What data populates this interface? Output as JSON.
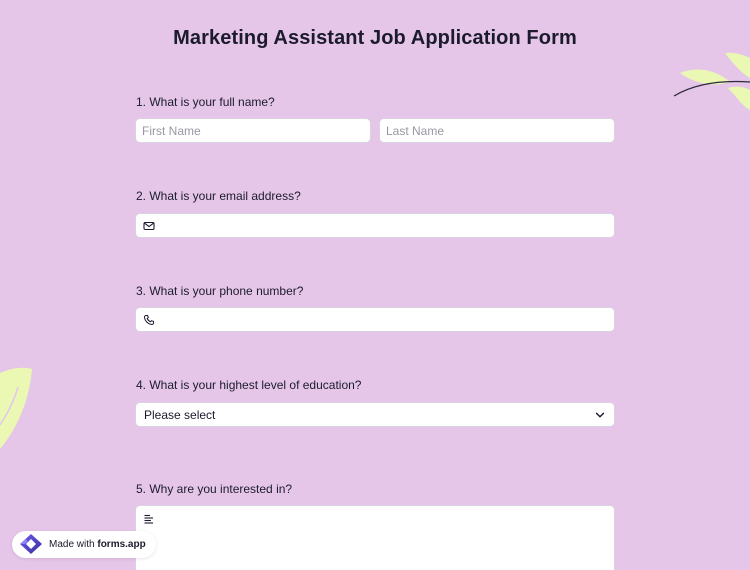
{
  "form": {
    "title": "Marketing Assistant Job Application Form"
  },
  "questions": [
    {
      "label": "1.  What is your full name?",
      "first_name_placeholder": "First Name",
      "last_name_placeholder": "Last Name"
    },
    {
      "label": "2. What is your email address?",
      "icon": "envelope-icon"
    },
    {
      "label": "3. What is your phone number?",
      "icon": "phone-icon"
    },
    {
      "label": "4. What is your highest level of education?",
      "selected_value": "Please select",
      "icon": "chevron-down-icon"
    },
    {
      "label": "5. Why are you interested in?",
      "icon": "text-lines-icon"
    }
  ],
  "badge": {
    "prefix": "Made with ",
    "brand": "forms.app"
  },
  "colors": {
    "background": "#e5c6e8",
    "leaf": "#eaf8b4",
    "brand_gradient_start": "#6b5cf0",
    "brand_gradient_end": "#3a2e9e"
  }
}
